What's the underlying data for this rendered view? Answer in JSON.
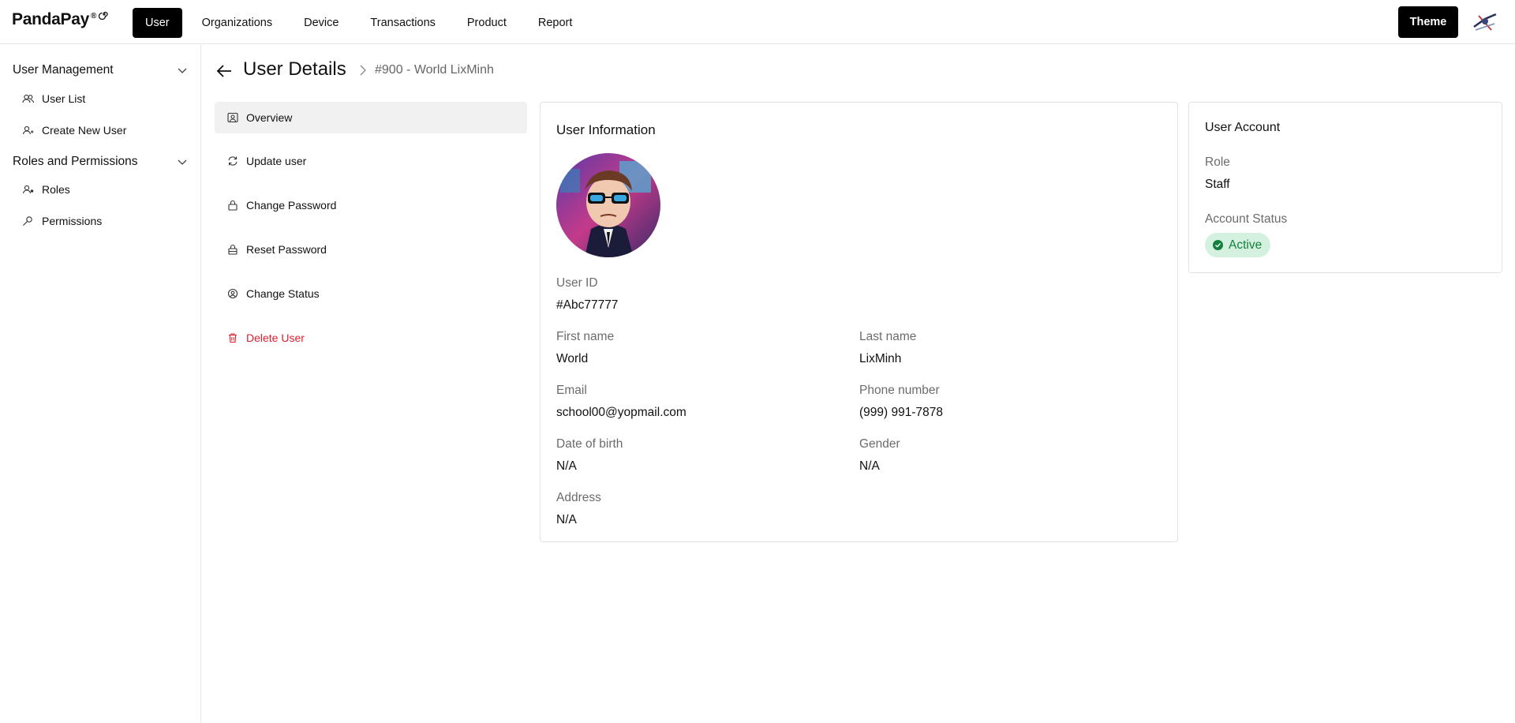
{
  "brand": {
    "name": "PandaPay",
    "mark": "®"
  },
  "nav": {
    "items": [
      {
        "label": "User",
        "active": true
      },
      {
        "label": "Organizations"
      },
      {
        "label": "Device"
      },
      {
        "label": "Transactions"
      },
      {
        "label": "Product"
      },
      {
        "label": "Report"
      }
    ],
    "theme_label": "Theme"
  },
  "sidebar": {
    "groups": [
      {
        "label": "User Management",
        "items": [
          {
            "label": "User List",
            "icon": "users-icon"
          },
          {
            "label": "Create New User",
            "icon": "user-plus-icon"
          }
        ]
      },
      {
        "label": "Roles and Permissions",
        "items": [
          {
            "label": "Roles",
            "icon": "user-role-icon"
          },
          {
            "label": "Permissions",
            "icon": "key-icon"
          }
        ]
      }
    ]
  },
  "header": {
    "title": "User Details",
    "breadcrumb": "#900 - World LixMinh"
  },
  "tabs": [
    {
      "label": "Overview",
      "icon": "user-square-icon",
      "active": true
    },
    {
      "label": "Update user",
      "icon": "refresh-icon"
    },
    {
      "label": "Change Password",
      "icon": "lock-icon"
    },
    {
      "label": "Reset Password",
      "icon": "lock-reset-icon"
    },
    {
      "label": "Change Status",
      "icon": "status-icon"
    },
    {
      "label": "Delete User",
      "icon": "trash-icon",
      "danger": true
    }
  ],
  "user_info": {
    "title": "User Information",
    "user_id_label": "User ID",
    "user_id": "#Abc77777",
    "first_name_label": "First name",
    "first_name": "World",
    "last_name_label": "Last name",
    "last_name": "LixMinh",
    "email_label": "Email",
    "email": "school00@yopmail.com",
    "phone_label": "Phone number",
    "phone": "(999) 991-7878",
    "dob_label": "Date of birth",
    "dob": "N/A",
    "gender_label": "Gender",
    "gender": "N/A",
    "address_label": "Address",
    "address": "N/A"
  },
  "account": {
    "title": "User Account",
    "role_label": "Role",
    "role": "Staff",
    "status_label": "Account Status",
    "status": "Active"
  },
  "colors": {
    "accent": "#000000",
    "danger": "#e11d2e",
    "success_bg": "#d4f1df",
    "success_text": "#15803d"
  }
}
